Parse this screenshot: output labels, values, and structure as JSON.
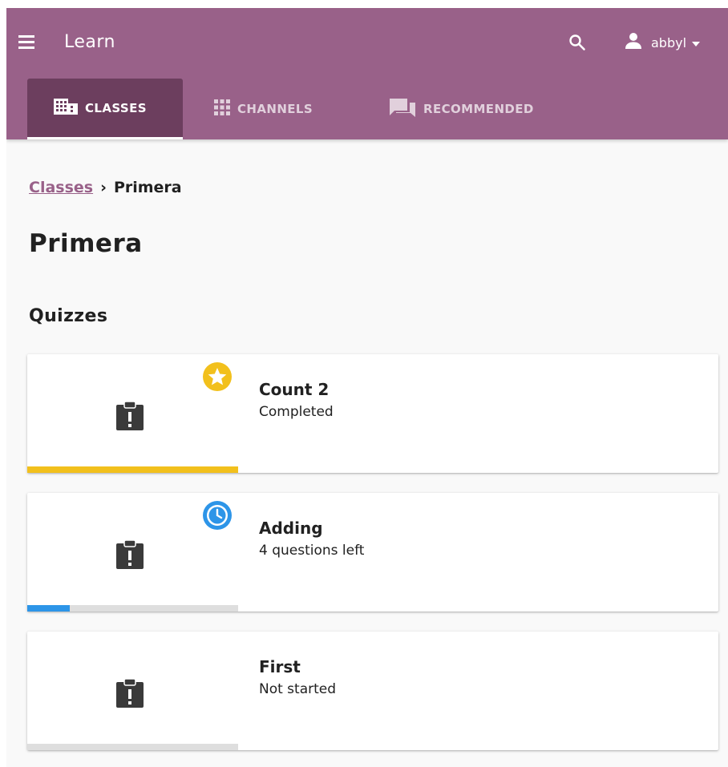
{
  "app": {
    "title": "Learn",
    "username": "abbyl"
  },
  "tabs": [
    {
      "label": "CLASSES",
      "icon": "classes-icon",
      "active": true
    },
    {
      "label": "CHANNELS",
      "icon": "channels-grid-icon",
      "active": false
    },
    {
      "label": "RECOMMENDED",
      "icon": "recommended-forum-icon",
      "active": false
    }
  ],
  "breadcrumb": {
    "parent": "Classes",
    "separator": "›",
    "current": "Primera"
  },
  "page": {
    "title": "Primera",
    "section_title": "Quizzes"
  },
  "quizzes": [
    {
      "title": "Count 2",
      "status": "Completed",
      "status_icon": "star-icon",
      "progress": 1.0,
      "progress_color": "#f2c01c"
    },
    {
      "title": "Adding",
      "status": "4 questions left",
      "status_icon": "clock-icon",
      "progress": 0.2,
      "progress_color": "#2d95e8"
    },
    {
      "title": "First",
      "status": "Not started",
      "status_icon": "",
      "progress": 0.0,
      "progress_color": "#2d95e8"
    }
  ],
  "colors": {
    "brand": "#996189",
    "brand_dark": "#6c3e5e",
    "completed": "#f2c01c",
    "in_progress": "#2d95e8",
    "track": "#dedede"
  }
}
